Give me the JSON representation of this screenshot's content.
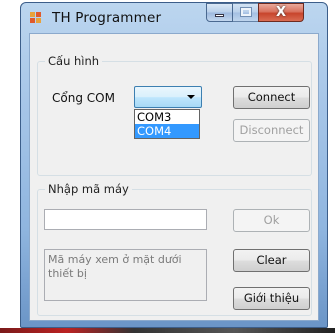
{
  "window": {
    "title": "TH Programmer",
    "close_glyph": "X",
    "icon": "app-grid-icon"
  },
  "config_group": {
    "legend": "Cấu hình",
    "port_label": "Cổng COM",
    "port_select": {
      "selected": "",
      "options": [
        "COM3",
        "COM4"
      ],
      "highlighted": "COM4"
    },
    "connect_label": "Connect",
    "disconnect_label": "Disconnect"
  },
  "machine_group": {
    "legend": "Nhập mã máy",
    "code_input": {
      "value": ""
    },
    "ok_label": "Ok",
    "hint_text": "Mã máy xem ở mặt dưới thiết bị",
    "clear_label": "Clear",
    "about_label": "Giới thiệu"
  },
  "colors": {
    "titlebar": "#a7c6e8",
    "close_button": "#c8452c",
    "selection": "#3399ff",
    "dialog_bg": "#f0f0f0"
  }
}
